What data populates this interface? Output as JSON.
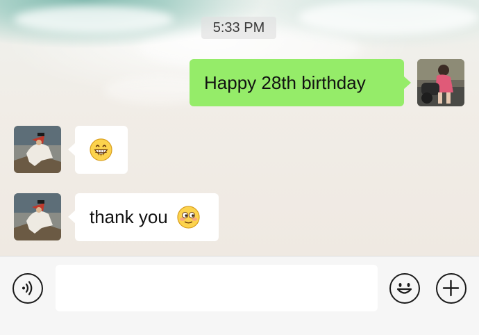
{
  "chat": {
    "timestamp": "5:33 PM",
    "messages": [
      {
        "direction": "outgoing",
        "text": "Happy 28th birthday",
        "emoji": ""
      },
      {
        "direction": "incoming",
        "text": "",
        "emoji": "grinning-face-emoji"
      },
      {
        "direction": "incoming",
        "text": "thank you",
        "emoji": "blushing-face-emoji"
      }
    ]
  },
  "input_bar": {
    "voice_button": "voice-icon",
    "message_value": "",
    "emoji_button": "smiley-icon",
    "more_button": "plus-icon"
  },
  "colors": {
    "outgoing_bubble": "#95ec69",
    "incoming_bubble": "#ffffff",
    "input_bar": "#f6f6f6"
  }
}
